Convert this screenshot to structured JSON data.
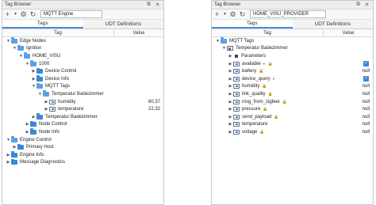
{
  "left": {
    "title": "Tag Browser",
    "provider": "MQTT Engine",
    "tabs": [
      "Tags",
      "UDT Definitions"
    ],
    "columns": {
      "tag": "Tag",
      "value": "Value"
    },
    "rows": [
      {
        "label": "Edge Nodes",
        "value": ""
      },
      {
        "label": "Ignition",
        "value": ""
      },
      {
        "label": "HOME_VISU",
        "value": ""
      },
      {
        "label": "1000",
        "value": ""
      },
      {
        "label": "Device Control",
        "value": ""
      },
      {
        "label": "Device Info",
        "value": ""
      },
      {
        "label": "MQTT Tags",
        "value": ""
      },
      {
        "label": "Temperatur Badezimmer",
        "value": ""
      },
      {
        "label": "humidity",
        "value": "80,37"
      },
      {
        "label": "temperature",
        "value": "22,32"
      },
      {
        "label": "Temperatur Badezimmer",
        "value": ""
      },
      {
        "label": "Node Control",
        "value": ""
      },
      {
        "label": "Node Info",
        "value": ""
      },
      {
        "label": "Engine Control",
        "value": ""
      },
      {
        "label": "Primary Host",
        "value": ""
      },
      {
        "label": "Engine Info",
        "value": ""
      },
      {
        "label": "Message Diagnostics",
        "value": ""
      }
    ]
  },
  "right": {
    "title": "Tag Browser",
    "provider": "HOME_VISU_PROVIDER",
    "tabs": [
      "Tags",
      "UDT Definitions"
    ],
    "columns": {
      "tag": "Tag",
      "value": "Value"
    },
    "rows": [
      {
        "label": "MQTT Tags",
        "value": ""
      },
      {
        "label": "Temperatur Badezimmer",
        "value": ""
      },
      {
        "label": "Parameters",
        "value": ""
      },
      {
        "label": "available",
        "value": ""
      },
      {
        "label": "battery",
        "value": "null"
      },
      {
        "label": "device_query",
        "value": ""
      },
      {
        "label": "humidity",
        "value": "null"
      },
      {
        "label": "link_quality",
        "value": "null"
      },
      {
        "label": "msg_from_zigbee",
        "value": "null"
      },
      {
        "label": "pressure",
        "value": "null"
      },
      {
        "label": "send_payload",
        "value": "null"
      },
      {
        "label": "temperature",
        "value": "null"
      },
      {
        "label": "voltage",
        "value": "null"
      }
    ]
  },
  "accent_color": "#3a87d6"
}
